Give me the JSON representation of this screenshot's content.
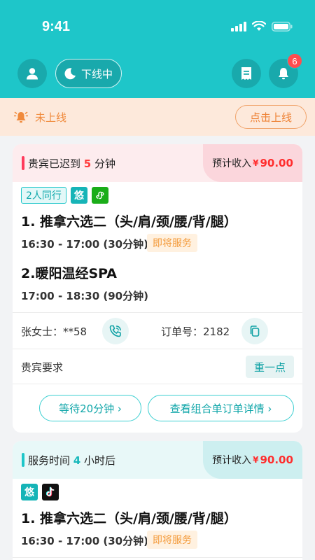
{
  "status_bar": {
    "time": "9:41"
  },
  "toolbar": {
    "status_label": "下线中",
    "notification_count": "6"
  },
  "offline_banner": {
    "text": "未上线",
    "button_label": "点击上线"
  },
  "orders": [
    {
      "head_prefix": "贵宾已迟到 ",
      "head_value": "5",
      "head_suffix": " 分钟",
      "income_label": "预计收入",
      "currency": "¥",
      "income_amount": "90.00",
      "tags": {
        "companion": "2人同行",
        "you": "悠"
      },
      "services": [
        {
          "name": "1. 推拿六选二（头/肩/颈/腰/背/腿）",
          "time": "16:30 - 17:00 (30分钟)",
          "status": "即将服务"
        },
        {
          "name": "2.暖阳温经SPA",
          "time": "17:00 - 18:30 (90分钟)"
        }
      ],
      "customer": "张女士：**58",
      "order_no": "订单号：2182",
      "request_label": "贵宾要求",
      "request_value": "重一点",
      "wait_button": "等待20分钟 ›",
      "detail_button": "查看组合单订单详情 ›"
    },
    {
      "head_prefix": "服务时间 ",
      "head_value": "4",
      "head_suffix": " 小时后",
      "income_label": "预计收入",
      "currency": "¥",
      "income_amount": "90.00",
      "tags": {
        "you": "悠"
      },
      "services": [
        {
          "name": "1. 推拿六选二（头/肩/颈/腰/背/腿）",
          "time": "16:30 - 17:00 (30分钟)",
          "status": "即将服务"
        }
      ]
    }
  ],
  "colors": {
    "brand": "#1ec6c9",
    "warning": "#f08a3c",
    "alert": "#ff3b3b"
  }
}
